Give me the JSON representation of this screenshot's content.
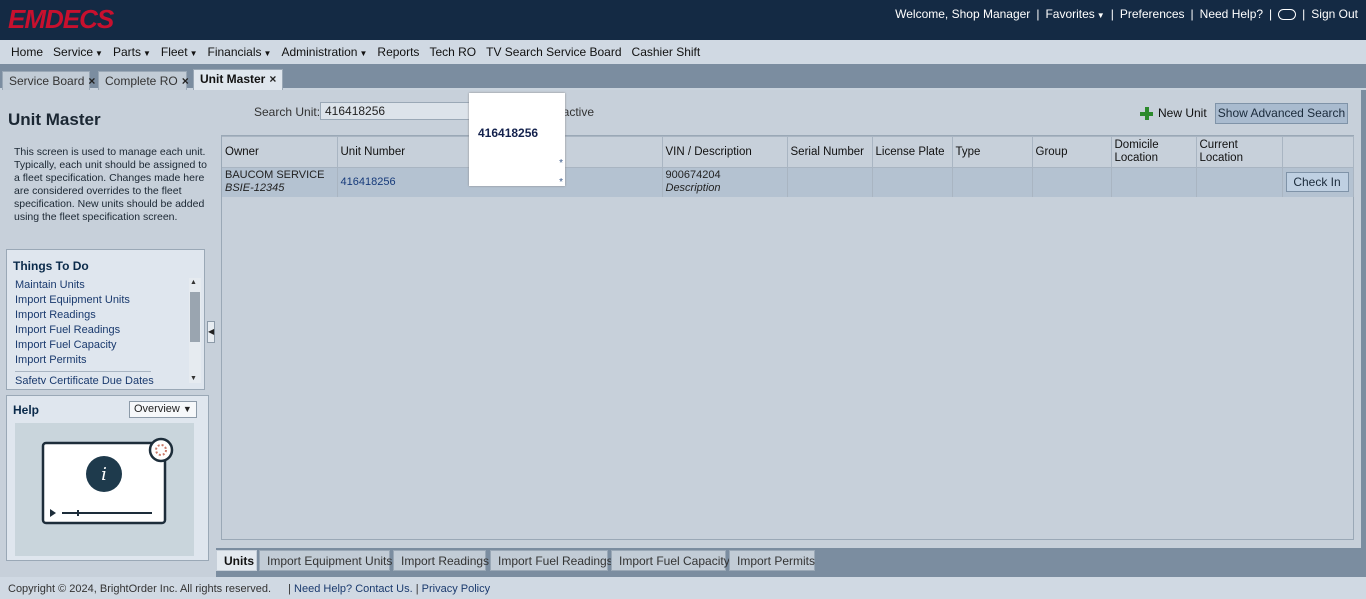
{
  "app": {
    "logo": "EMDECS"
  },
  "topbar": {
    "welcome": "Welcome, Shop Manager",
    "favorites": "Favorites",
    "preferences": "Preferences",
    "need_help": "Need Help?",
    "sign_out": "Sign Out",
    "separator": "|"
  },
  "menu": {
    "items": [
      {
        "label": "Home",
        "dropdown": false
      },
      {
        "label": "Service",
        "dropdown": true
      },
      {
        "label": "Parts",
        "dropdown": true
      },
      {
        "label": "Fleet",
        "dropdown": true
      },
      {
        "label": "Financials",
        "dropdown": true
      },
      {
        "label": "Administration",
        "dropdown": true
      },
      {
        "label": "Reports",
        "dropdown": false
      },
      {
        "label": "Tech RO",
        "dropdown": false
      },
      {
        "label": "TV Search Service Board",
        "dropdown": false
      },
      {
        "label": "Cashier Shift",
        "dropdown": false
      }
    ]
  },
  "tabs": [
    {
      "label": "Service Board",
      "active": false
    },
    {
      "label": "Complete RO",
      "active": false
    },
    {
      "label": "Unit Master",
      "active": true
    }
  ],
  "close_glyph": "×",
  "left": {
    "title": "Unit Master",
    "description": "This screen is used to manage each unit. Typically, each unit should be assigned to a fleet specification. Changes made here are considered overrides to the fleet specification. New units should be added using the fleet specification screen.",
    "todo": {
      "title": "Things To Do",
      "items": [
        "Maintain Units",
        "Import Equipment Units",
        "Import Readings",
        "Import Fuel Readings",
        "Import Fuel Capacity",
        "Import Permits"
      ],
      "items_after_divider": [
        "Safety Certificate Due Dates"
      ]
    },
    "help": {
      "title": "Help",
      "selected": "Overview"
    }
  },
  "search": {
    "label": "Search Unit:",
    "value": "416418256",
    "inactive_label": "nactive"
  },
  "actions": {
    "new_unit": "New Unit",
    "advanced_search": "Show Advanced Search"
  },
  "grid": {
    "headers": [
      "Owner",
      "Unit Number",
      "",
      "VIN / Description",
      "Serial Number",
      "License Plate",
      "Type",
      "Group",
      "Domicile Location",
      "Current Location",
      ""
    ],
    "rows": [
      {
        "owner": "BAUCOM SERVICE",
        "owner_sub": "BSIE-12345",
        "unit_number": "416418256",
        "vin": "900674204",
        "vin_sub": "Description",
        "serial": "",
        "plate": "",
        "type": "",
        "group": "",
        "domicile": "",
        "current": "",
        "action": "Check In"
      }
    ]
  },
  "popup": {
    "value": "416418256",
    "marker": "*"
  },
  "bottom_tabs": [
    {
      "label": "Units",
      "active": true
    },
    {
      "label": "Import Equipment Units",
      "active": false
    },
    {
      "label": "Import Readings",
      "active": false
    },
    {
      "label": "Import Fuel Readings",
      "active": false
    },
    {
      "label": "Import Fuel Capacity",
      "active": false
    },
    {
      "label": "Import Permits",
      "active": false
    }
  ],
  "footer": {
    "copyright": "Copyright © 2024, BrightOrder Inc. All rights reserved.",
    "help_link": "Need Help? Contact Us.",
    "privacy_link": "Privacy Policy",
    "separator": "|"
  },
  "colors": {
    "topbar": "#142a44",
    "logo": "#c8102e",
    "menubar": "#d0d9e3",
    "panel": "#c7d0da",
    "selected_row": "#b4c2d1",
    "link": "#1a3a6e",
    "plus_icon": "#2c8a2c"
  }
}
